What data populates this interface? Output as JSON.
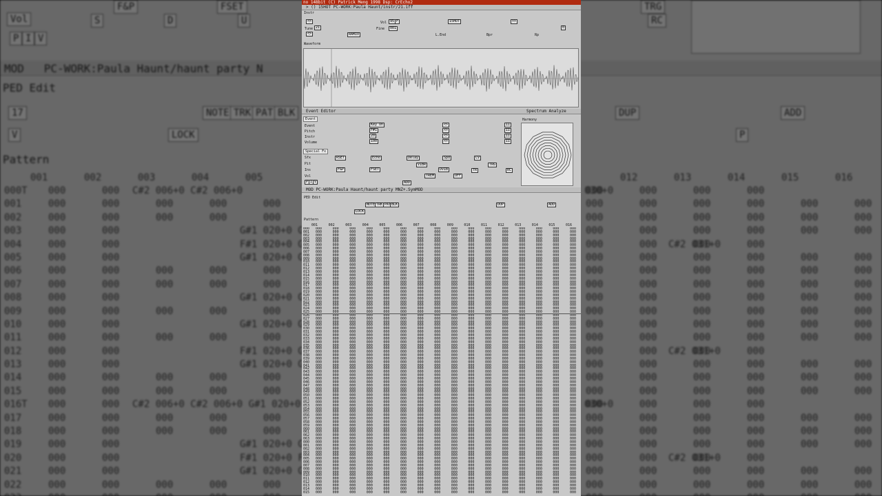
{
  "background": {
    "window_title": "MOD   PC-WORK:Paula Haunt/haunt party N",
    "ped_label": "PED Edit",
    "pattern_label": "Pattern",
    "top_labels": [
      "Vol",
      "S",
      "D",
      "U",
      "F&P",
      "FSET",
      "TRG",
      "RC"
    ],
    "top_left_buttons": [
      "P",
      "I",
      "V"
    ],
    "position_value": "17",
    "mode_buttons": [
      "NOTE",
      "TRK",
      "PAT",
      "BLK"
    ],
    "lock_label": "LOCK",
    "v_label": "V",
    "dup_label": "DUP",
    "add_label": "ADD",
    "p_label": "P",
    "track_headers": [
      "001",
      "002",
      "003",
      "004",
      "005",
      "012",
      "013",
      "014",
      "015",
      "016"
    ],
    "rows": [
      {
        "line": "000T",
        "c4": "C#2 006+0 C#2 006+0",
        "c10": "030+0"
      },
      {
        "line": "001",
        "c4": "",
        "c10": ""
      },
      {
        "line": "002",
        "c4": "",
        "c10": ""
      },
      {
        "line": "003",
        "c4": "G#1 020+0 G",
        "c10": ""
      },
      {
        "line": "004",
        "c4": "F#1 020+0 G",
        "c10": "C#2 031+0"
      },
      {
        "line": "005",
        "c4": "G#1 020+0 G",
        "c10": ""
      },
      {
        "line": "006",
        "c4": "",
        "c10": ""
      },
      {
        "line": "007",
        "c4": "",
        "c10": ""
      },
      {
        "line": "008",
        "c4": "G#1 020+0 G",
        "c10": ""
      },
      {
        "line": "009",
        "c4": "",
        "c10": ""
      },
      {
        "line": "010",
        "c4": "G#1 020+0 G",
        "c10": ""
      },
      {
        "line": "011",
        "c4": "",
        "c10": ""
      },
      {
        "line": "012",
        "c4": "F#1 020+0 G",
        "c10": "C#2 031+0"
      },
      {
        "line": "013",
        "c4": "G#1 020+0 G",
        "c10": ""
      },
      {
        "line": "014",
        "c4": "",
        "c10": ""
      },
      {
        "line": "015",
        "c4": "",
        "c10": ""
      },
      {
        "line": "016T",
        "c4": "C#2 006+0 C#2 006+0 G#1 020+0 G",
        "c10": "030+0"
      },
      {
        "line": "017",
        "c4": "",
        "c10": ""
      },
      {
        "line": "018",
        "c4": "",
        "c10": ""
      },
      {
        "line": "019",
        "c4": "G#1 020+0 G",
        "c10": ""
      },
      {
        "line": "020",
        "c4": "F#1 020+0 F",
        "c10": "C#2 031+0"
      },
      {
        "line": "021",
        "c4": "G#1 020+0 G",
        "c10": ""
      },
      {
        "line": "022",
        "c4": "",
        "c10": ""
      },
      {
        "line": "023",
        "c4": "",
        "c10": ""
      }
    ],
    "filler": "000"
  },
  "window": {
    "title": "no 148bit (C) Patrick Meng 1998  Dsp: CrEcho2",
    "instr_path": "> () 15HOT PC-WORK:Paula Haunt/instr/21.iff",
    "instr_label": "Instr",
    "instr_controls": [
      "Tune",
      "21",
      "Vol",
      "95",
      "F",
      "15HOT",
      "Fine",
      "001",
      "L.End",
      "RAMIO",
      "Bpr",
      "Rp",
      "0"
    ],
    "waveform_label": "Waveform",
    "event_editor_title": "Event Editor",
    "spectrum_title": "Spectrum Analyze",
    "harmony_label": "Harmony",
    "event_label": "Event",
    "event_rows": [
      "Event",
      "Pitch",
      "Instr",
      "Volume"
    ],
    "event_values": [
      "Key On",
      "F#1",
      "20",
      "100"
    ],
    "special_fx_label": "Special Fx",
    "fx_rows": [
      "Sfx",
      "Pit",
      "Ins",
      "Vol",
      "P",
      "I",
      "V"
    ],
    "fx_buttons": [
      "RSET",
      "Echo",
      "Delay",
      "Spd",
      "CV",
      "F&P",
      "FSET",
      "VIBR",
      "DVIB",
      "TRG",
      "TREM",
      "OFF",
      "TR",
      "RC",
      "ADD"
    ],
    "mod_path": "MOD  PC-WORK:Paula Haunt/haunt party MNZ+.SymMOD",
    "ped_label": "PED Edit",
    "pattern_label": "Pattern",
    "mini_buttons": [
      "NOTE",
      "TRK",
      "PAT",
      "BLK",
      "LOCK",
      "DUP",
      "ADD"
    ],
    "track_headers": [
      "001",
      "002",
      "003",
      "004",
      "005",
      "006",
      "007",
      "008",
      "009",
      "010",
      "011",
      "012",
      "013",
      "014",
      "015",
      "016"
    ]
  },
  "colors": {
    "titlebar": "#b02a10",
    "panel": "#c8c8c8",
    "background_dim": "#a8a8a8"
  }
}
